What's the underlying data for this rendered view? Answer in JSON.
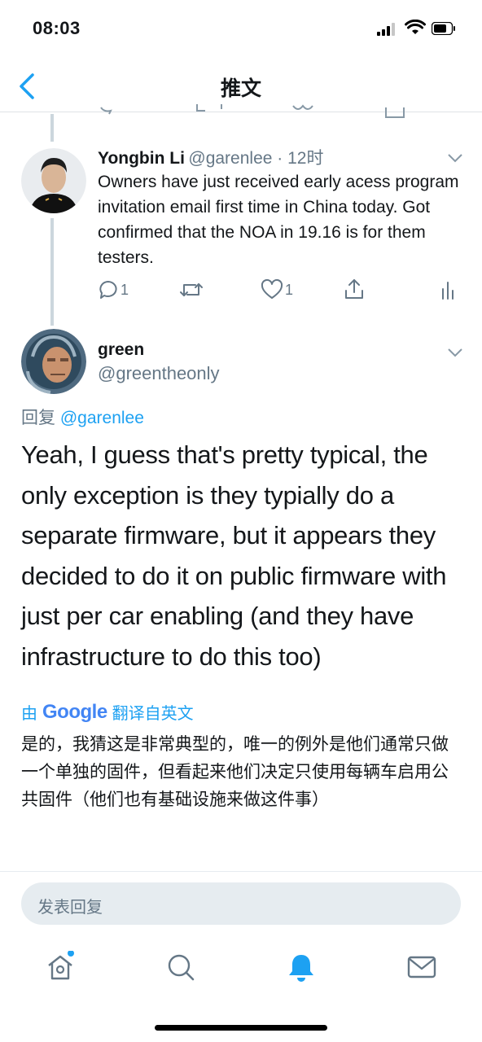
{
  "status_bar": {
    "time": "08:03"
  },
  "nav": {
    "title": "推文"
  },
  "parent_tweet": {
    "author_name": "Yongbin Li",
    "handle_time": "@garenlee · 12时",
    "text": "Owners have just received early acess program invitation email first time in China today. Got confirmed that the NOA in 19.16 is for them testers.",
    "reply_count": "1",
    "like_count": "1"
  },
  "focus_tweet": {
    "author_name": "green",
    "handle": "@greentheonly",
    "reply_prefix": "回复",
    "reply_to": "@garenlee",
    "text": "Yeah, I guess that's pretty typical, the only exception is they typially do a separate firmware, but it appears they decided to do it on public firmware with just per car enabling (and they have infrastructure to do this too)",
    "translation": {
      "by": "由",
      "google": "Google",
      "from": "翻译自英文",
      "text": "是的，我猜这是非常典型的，唯一的例外是他们通常只做一个单独的固件，但看起来他们决定只使用每辆车启用公共固件（他们也有基础设施来做这件事）"
    }
  },
  "reply": {
    "placeholder": "发表回复"
  },
  "colors": {
    "accent": "#1da1f2",
    "muted": "#657786",
    "text": "#14171a"
  },
  "tabs": [
    "home-icon",
    "search-icon",
    "notifications-icon",
    "messages-icon"
  ]
}
